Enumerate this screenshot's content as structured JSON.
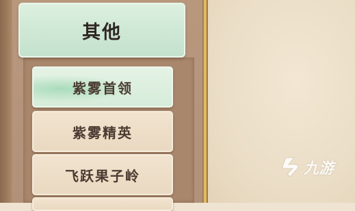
{
  "category": {
    "title": "其他"
  },
  "items": [
    {
      "label": "紫雾首领",
      "state": "selected"
    },
    {
      "label": "紫雾精英",
      "state": "normal"
    },
    {
      "label": "飞跃果子岭",
      "state": "normal"
    },
    {
      "label": "",
      "state": "normal"
    }
  ],
  "watermark": {
    "text": "九游",
    "logo_icon": "nine-game-logo"
  },
  "colors": {
    "selected_accent": "#cfe8d6",
    "item_bg": "#ead9c1",
    "panel_brown": "#b2917a",
    "divider_gold": "#d9b45c",
    "parchment": "#eadcc4"
  }
}
